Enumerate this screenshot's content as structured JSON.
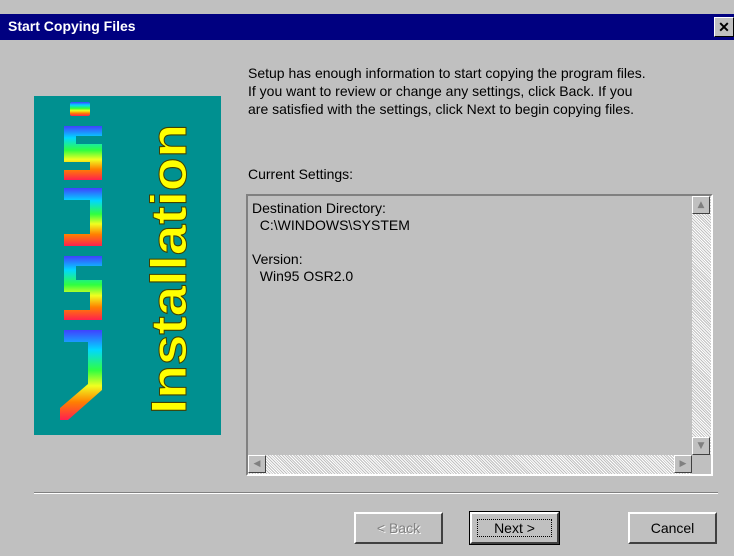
{
  "window": {
    "title": "Start Copying Files",
    "close_glyph": "✕"
  },
  "banner": {
    "logo_text": "ASUS",
    "caption": "Installation"
  },
  "intro_text": "Setup has enough information to start copying the program files.\nIf you want to review or change any settings, click Back.  If you\nare satisfied with the settings, click Next to begin copying files.",
  "settings": {
    "label": "Current Settings:",
    "content": "Destination Directory:\n  C:\\WINDOWS\\SYSTEM\n\nVersion:\n  Win95 OSR2.0"
  },
  "buttons": {
    "back": "< Back",
    "next": "Next >",
    "cancel": "Cancel"
  }
}
